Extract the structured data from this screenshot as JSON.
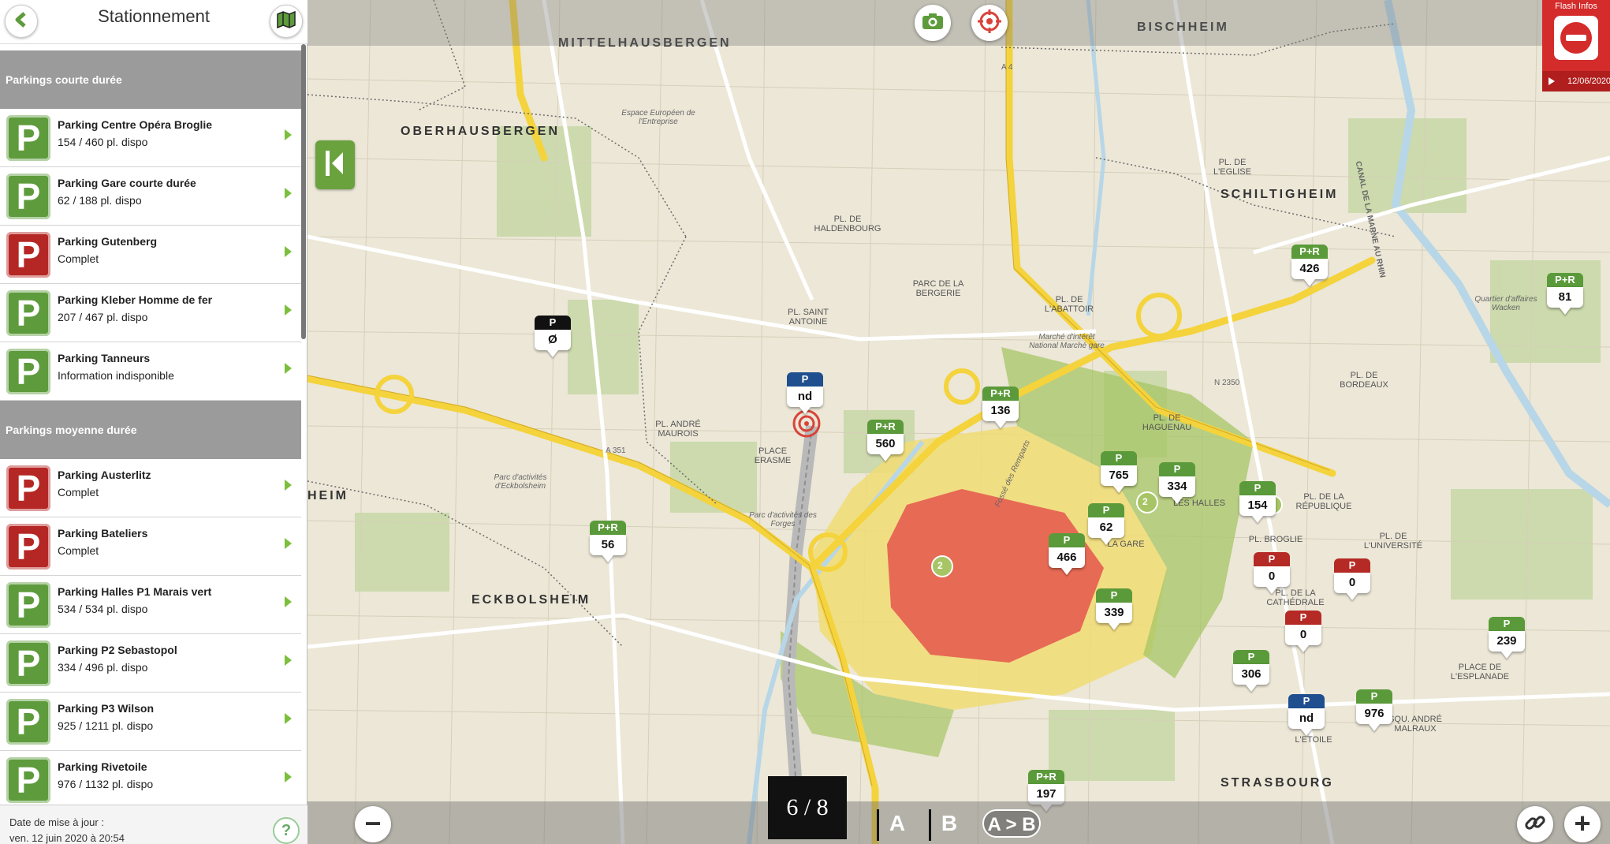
{
  "sidebar": {
    "title": "Stationnement",
    "sections": [
      {
        "heading": "Parkings courte durée",
        "items": [
          {
            "name": "Parking Centre Opéra Broglie",
            "info": "154 / 460 pl. dispo",
            "status": "green"
          },
          {
            "name": "Parking Gare courte durée",
            "info": "62 / 188 pl. dispo",
            "status": "green"
          },
          {
            "name": "Parking Gutenberg",
            "info": "Complet",
            "status": "red"
          },
          {
            "name": "Parking Kleber Homme de fer",
            "info": "207 / 467 pl. dispo",
            "status": "green"
          },
          {
            "name": "Parking Tanneurs",
            "info": "Information indisponible",
            "status": "green"
          }
        ]
      },
      {
        "heading": "Parkings moyenne durée",
        "items": [
          {
            "name": "Parking Austerlitz",
            "info": "Complet",
            "status": "red"
          },
          {
            "name": "Parking Bateliers",
            "info": "Complet",
            "status": "red"
          },
          {
            "name": "Parking Halles P1 Marais vert",
            "info": "534 / 534 pl. dispo",
            "status": "green"
          },
          {
            "name": "Parking P2 Sebastopol",
            "info": "334 / 496 pl. dispo",
            "status": "green"
          },
          {
            "name": "Parking P3 Wilson",
            "info": "925 / 1211 pl. dispo",
            "status": "green"
          },
          {
            "name": "Parking Rivetoile",
            "info": "976 / 1132 pl. dispo",
            "status": "green"
          }
        ]
      }
    ],
    "badge_letter": "P",
    "footer_line1": "Date de mise à jour :",
    "footer_line2": "ven. 12 juin 2020 à 20:54",
    "help_label": "?"
  },
  "flash": {
    "title": "Flash Infos",
    "date": "12/06/2020"
  },
  "bottom": {
    "page": "6 / 8",
    "a_label": "A",
    "b_label": "B",
    "ab_label": "A > B",
    "zoom_out": "−",
    "zoom_in": "+"
  },
  "map": {
    "labels_big": [
      {
        "text": "MITTELHAUSBERGEN"
      },
      {
        "text": "OBERHAUSBERGEN"
      },
      {
        "text": "BISCHHEIM"
      },
      {
        "text": "SCHILTIGHEIM"
      },
      {
        "text": "ECKBOLSHEIM"
      },
      {
        "text": "STRASBOURG"
      },
      {
        "text": "HEIM"
      }
    ],
    "labels_small": [
      {
        "text": "PL. DE HALDENBOURG"
      },
      {
        "text": "PARC DE LA BERGERIE"
      },
      {
        "text": "PL. SAINT ANTOINE"
      },
      {
        "text": "PL. ANDRÉ MAUROIS"
      },
      {
        "text": "PLACE ERASME"
      },
      {
        "text": "PL. DE L'ABATTOIR"
      },
      {
        "text": "PL. DE L'EGLISE"
      },
      {
        "text": "PL. DE BORDEAUX"
      },
      {
        "text": "PL. DE HAGUENAU"
      },
      {
        "text": "PL. DE LA RÉPUBLIQUE"
      },
      {
        "text": "PL. BROGLIE"
      },
      {
        "text": "PL. DE LA CATHÉDRALE"
      },
      {
        "text": "PL. DE L'UNIVERSITÉ"
      },
      {
        "text": "PLACE DE L'ESPLANADE"
      },
      {
        "text": "LA GARE"
      },
      {
        "text": "LES HALLES"
      },
      {
        "text": "SQU. ANDRÉ MALRAUX"
      },
      {
        "text": "L'ETOILE"
      }
    ],
    "labels_tiny": [
      {
        "text": "Espace Européen de l'Entreprise"
      },
      {
        "text": "Parc d'activités d'Eckbolsheim"
      },
      {
        "text": "Parc d'activités des Forges"
      },
      {
        "text": "Marché d'intérêt National Marché gare"
      },
      {
        "text": "Quartier d'affaires Wacken"
      },
      {
        "text": "CANAL DE LA MARNE AU RHIN"
      },
      {
        "text": "Fossé des Remparts"
      },
      {
        "text": "A 351"
      },
      {
        "text": "A 4"
      },
      {
        "text": "N 2350"
      }
    ],
    "markers": [
      {
        "head": "P",
        "value": "Ø",
        "color": "black"
      },
      {
        "head": "P",
        "value": "nd",
        "color": "blue"
      },
      {
        "head": "P+R",
        "value": "560",
        "color": "green"
      },
      {
        "head": "P+R",
        "value": "56",
        "color": "green"
      },
      {
        "head": "P+R",
        "value": "136",
        "color": "green"
      },
      {
        "head": "P+R",
        "value": "426",
        "color": "green"
      },
      {
        "head": "P+R",
        "value": "81",
        "color": "green"
      },
      {
        "head": "P",
        "value": "765",
        "color": "green"
      },
      {
        "head": "P",
        "value": "334",
        "color": "green"
      },
      {
        "head": "P",
        "value": "154",
        "color": "green"
      },
      {
        "head": "P",
        "value": "62",
        "color": "green"
      },
      {
        "head": "P",
        "value": "466",
        "color": "green"
      },
      {
        "head": "P",
        "value": "0",
        "color": "red"
      },
      {
        "head": "P",
        "value": "0",
        "color": "red"
      },
      {
        "head": "P",
        "value": "0",
        "color": "red"
      },
      {
        "head": "P",
        "value": "339",
        "color": "green"
      },
      {
        "head": "P",
        "value": "306",
        "color": "green"
      },
      {
        "head": "P",
        "value": "nd",
        "color": "blue"
      },
      {
        "head": "P",
        "value": "976",
        "color": "green"
      },
      {
        "head": "P",
        "value": "239",
        "color": "green"
      },
      {
        "head": "P+R",
        "value": "197",
        "color": "green"
      }
    ],
    "cluster_labels": [
      {
        "text": "2"
      },
      {
        "text": "2"
      },
      {
        "text": "2"
      }
    ]
  },
  "colors": {
    "accent_green": "#5e9b3c",
    "alert_red": "#b52724",
    "section_grey": "#9b9b9b"
  },
  "icons": [
    "back-arrow-icon",
    "map-toggle-icon",
    "camera-icon",
    "locate-icon",
    "no-entry-icon",
    "collapse-panel-icon",
    "link-icon",
    "help-icon"
  ]
}
